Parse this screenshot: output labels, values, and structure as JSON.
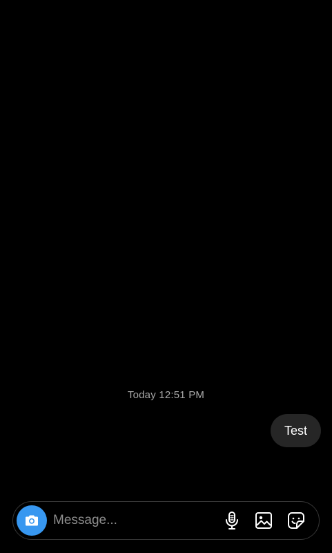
{
  "thread": {
    "timestamp": "Today 12:51 PM",
    "messages": [
      {
        "text": "Test",
        "from": "me"
      }
    ]
  },
  "composer": {
    "placeholder": "Message...",
    "value": "",
    "icons": {
      "camera": "camera-icon",
      "mic": "microphone-icon",
      "gallery": "image-icon",
      "sticker": "sticker-icon"
    }
  },
  "colors": {
    "background": "#000000",
    "bubble": "#262626",
    "camera_button": "#3797f0",
    "timestamp_text": "#a8a8a8",
    "placeholder_text": "#8e8e8e",
    "composer_border": "#363636"
  }
}
